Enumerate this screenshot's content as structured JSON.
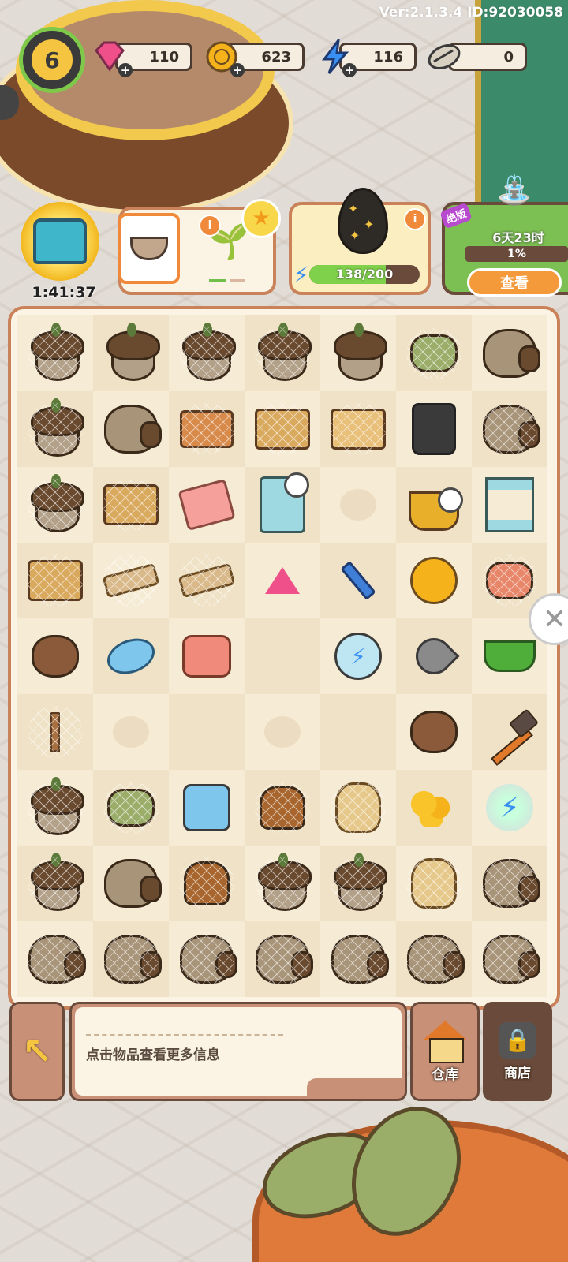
{
  "version_text": "Ver:2.1.3.4 ID:92030058",
  "player": {
    "level": "6"
  },
  "resources": [
    {
      "name": "gems",
      "icon": "gem-icon",
      "value": "110",
      "color": "#f0508a"
    },
    {
      "name": "coins",
      "icon": "coin-icon",
      "value": "623",
      "color": "#f5b21a"
    },
    {
      "name": "energy",
      "icon": "lightning-icon",
      "value": "116",
      "color": "#3a8ff2"
    },
    {
      "name": "seeds",
      "icon": "sunflower-seed-icon",
      "value": "0",
      "color": "#5a5a5a"
    }
  ],
  "chest": {
    "timer": "1:41:37"
  },
  "egg_card": {
    "progress_text": "138/200",
    "progress": 0.69
  },
  "event_card": {
    "tag": "绝版",
    "time_left": "6天23时",
    "percent": "1%",
    "view_button": "查看"
  },
  "board": {
    "columns": 7,
    "rows": 9,
    "cells": [
      [
        "acorn-web",
        "acorn",
        "acorn-web",
        "acorn-web",
        "acorn",
        "rolls-web",
        "sack"
      ],
      [
        "acorn-web",
        "sack",
        "toolbox-web",
        "box-web",
        "box-open-web",
        "boots",
        "sack-web"
      ],
      [
        "acorn-web",
        "box-web",
        "towel",
        "cabinet-timer",
        "empty-paw",
        "pen-bag-timer",
        "shelf"
      ],
      [
        "box-web",
        "plank-web",
        "plank-web",
        "gems",
        "screw",
        "coin",
        "meat-web"
      ],
      [
        "gloves",
        "soap",
        "watering-can",
        "empty",
        "energy-orb",
        "trowel",
        "dustpan"
      ],
      [
        "sapling-web",
        "empty-paw",
        "empty",
        "empty-paw",
        "empty",
        "gloves",
        "hammer"
      ],
      [
        "acorn-web",
        "rolls-web",
        "gem-bag",
        "vase-web",
        "sachet-web",
        "coin-pile",
        "glowing-pen-bag"
      ],
      [
        "acorn-web",
        "sack",
        "vase-web",
        "acorn-web",
        "acorn-web",
        "sachet-web",
        "sack-web"
      ],
      [
        "sack-web",
        "sack-web",
        "sack-web",
        "sack-web",
        "sack-web",
        "sack-web",
        "sack-web"
      ]
    ]
  },
  "info_panel": {
    "hint": "点击物品查看更多信息"
  },
  "buttons": {
    "warehouse": "仓库",
    "shop": "商店"
  }
}
